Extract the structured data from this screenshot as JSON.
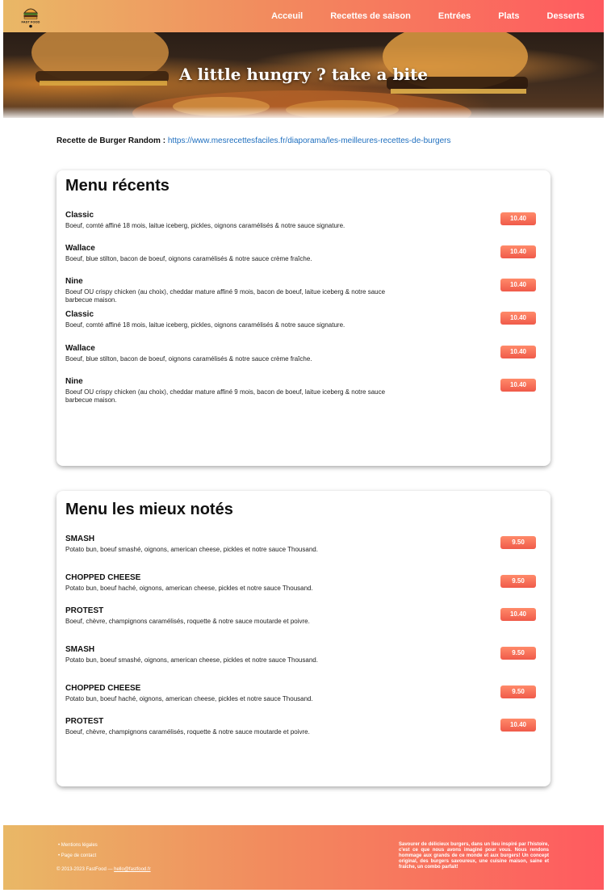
{
  "nav": {
    "logo_text": "FAST FOOD",
    "links": [
      "Acceuil",
      "Recettes de saison",
      "Entrées",
      "Plats",
      "Desserts"
    ]
  },
  "hero": {
    "title": "A little hungry ? take a bite"
  },
  "recipe": {
    "label": "Recette de Burger Random :",
    "link": "https://www.mesrecettesfaciles.fr/diaporama/les-meilleures-recettes-de-burgers"
  },
  "recent_menu": {
    "title": "Menu récents",
    "items": [
      {
        "name": "Classic",
        "desc": "Boeuf, comté affiné 18 mois, laitue iceberg, pickles, oignons caramélisés & notre sauce signature.",
        "price": "10.40"
      },
      {
        "name": "Wallace",
        "desc": "Boeuf, blue stilton, bacon de boeuf, oignons caramélisés & notre sauce crème fraîche.",
        "price": "10.40"
      },
      {
        "name": "Nine",
        "desc": "Boeuf OU crispy chicken (au choix), cheddar mature affiné 9 mois, bacon de boeuf, laitue iceberg & notre sauce barbecue maison.",
        "price": "10.40"
      },
      {
        "name": "Classic",
        "desc": "Boeuf, comté affiné 18 mois, laitue iceberg, pickles, oignons caramélisés & notre sauce signature.",
        "price": "10.40"
      },
      {
        "name": "Wallace",
        "desc": "Boeuf, blue stilton, bacon de boeuf, oignons caramélisés & notre sauce crème fraîche.",
        "price": "10.40"
      },
      {
        "name": "Nine",
        "desc": "Boeuf OU crispy chicken (au choix), cheddar mature affiné 9 mois, bacon de boeuf, laitue iceberg & notre sauce barbecue maison.",
        "price": "10.40"
      }
    ]
  },
  "top_menu": {
    "title": "Menu les mieux notés",
    "items": [
      {
        "name": "SMASH",
        "desc": "Potato bun, boeuf smashé, oignons, american cheese, pickles et notre sauce Thousand.",
        "price": "9.50"
      },
      {
        "name": "CHOPPED CHEESE",
        "desc": "Potato bun, boeuf haché, oignons, american cheese, pickles et notre sauce Thousand.",
        "price": "9.50"
      },
      {
        "name": "PROTEST",
        "desc": "Boeuf, chèvre, champignons caramélisés, roquette & notre sauce moutarde et poivre.",
        "price": "10.40"
      },
      {
        "name": "SMASH",
        "desc": "Potato bun, boeuf smashé, oignons, american cheese, pickles et notre sauce Thousand.",
        "price": "9.50"
      },
      {
        "name": "CHOPPED CHEESE",
        "desc": "Potato bun, boeuf haché, oignons, american cheese, pickles et notre sauce Thousand.",
        "price": "9.50"
      },
      {
        "name": "PROTEST",
        "desc": "Boeuf, chèvre, champignons caramélisés, roquette & notre sauce moutarde et poivre.",
        "price": "10.40"
      }
    ]
  },
  "footer": {
    "links": [
      "Mentions légales",
      "Page de contact"
    ],
    "copyright": "© 2013-2023 FastFood —",
    "email": "hello@fastfood.fr",
    "about": "Savourer de délicieux burgers, dans un lieu inspiré par l'histoire, c'est ce que nous avons imaginé pour vous. Nous rendons hommage aux grands de ce monde et aux burgers! Un concept original, des burgers savoureux, une cuisine maison, saine et fraîche, un combo parfait!"
  }
}
